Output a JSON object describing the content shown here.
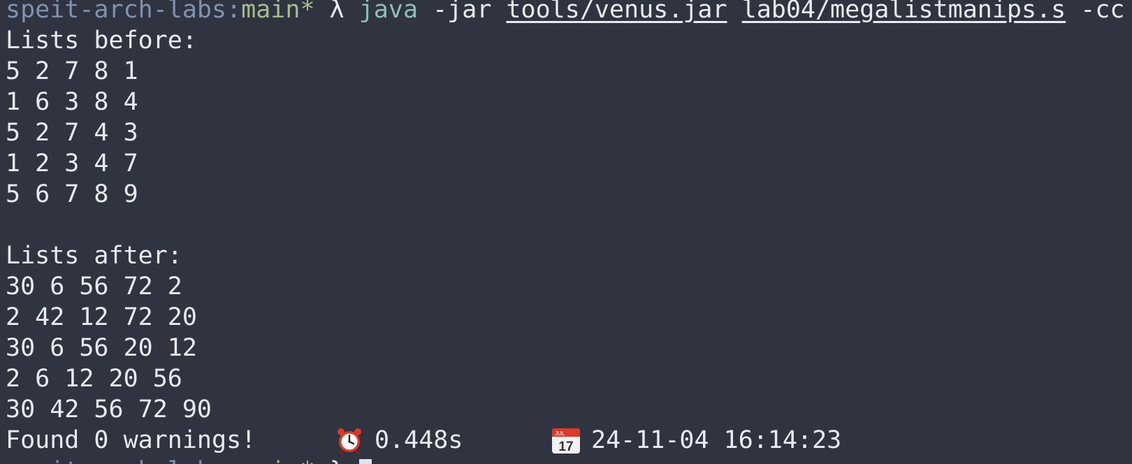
{
  "prompt": {
    "repo": "speit-arch-labs:",
    "branch": "main*",
    "symbol": " λ ",
    "program": "java",
    "arg_flag": " -jar ",
    "arg_jar": "tools/venus.jar",
    "arg_space": " ",
    "arg_file": "lab04/megalistmanips.s",
    "arg_tail": " -cc"
  },
  "output": {
    "before_header": "Lists before:",
    "before_lists": [
      "5 2 7 8 1",
      "1 6 3 8 4",
      "5 2 7 4 3",
      "1 2 3 4 7",
      "5 6 7 8 9"
    ],
    "after_header": "Lists after:",
    "after_lists": [
      "30 6 56 72 2",
      "2 42 12 72 20",
      "30 6 56 20 12",
      "2 6 12 20 56",
      "30 42 56 72 90"
    ]
  },
  "status": {
    "warnings": "Found 0 warnings!",
    "elapsed": "0.448s",
    "timestamp": "24-11-04 16:14:23",
    "calendar_month": "JUL",
    "calendar_day": "17",
    "alarm_icon": "alarm-clock-icon",
    "calendar_icon": "calendar-icon"
  },
  "next_prompt": {
    "repo": "speit-arch-labs:",
    "branch": "main*",
    "symbol": " λ "
  },
  "colors": {
    "background": "#2f3440",
    "foreground": "#e9ebf0",
    "repo": "#7f93b0",
    "branch": "#a3be8c",
    "command": "#8fbcbb"
  }
}
